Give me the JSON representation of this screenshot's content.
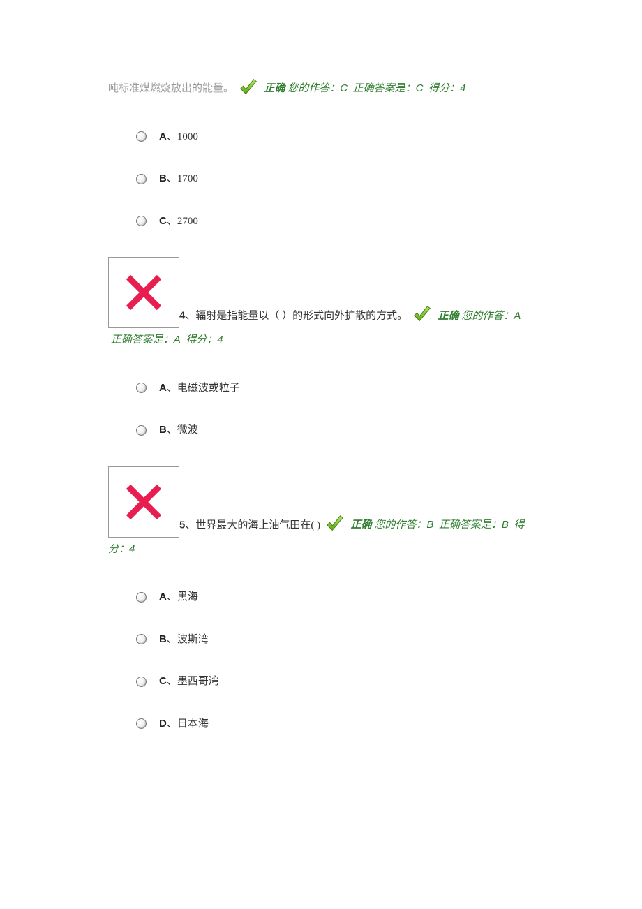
{
  "q3": {
    "intro_fragment": "吨标准煤燃烧放出的能量。",
    "feedback_correct": "正确",
    "feedback_your": "您的作答：",
    "feedback_your_v": "C",
    "feedback_right": "正确答案是：",
    "feedback_right_v": "C",
    "feedback_score_l": "得分：",
    "feedback_score_v": "4",
    "options": [
      {
        "letter": "A",
        "text": "1000"
      },
      {
        "letter": "B",
        "text": "1700"
      },
      {
        "letter": "C",
        "text": "2700"
      }
    ]
  },
  "q4": {
    "num": "4",
    "text_before": "、辐射是指能量以（  ）的形式向外扩散的方式。",
    "feedback_correct": "正确",
    "feedback_your": "您的作答：",
    "feedback_your_v": "A",
    "feedback_right": "正确答案是：",
    "feedback_right_v": "A",
    "feedback_score_l": "得分：",
    "feedback_score_v": "4",
    "options": [
      {
        "letter": "A",
        "text": "电磁波或粒子"
      },
      {
        "letter": "B",
        "text": "微波"
      }
    ]
  },
  "q5": {
    "num": "5",
    "text_before": "、世界最大的海上油气田在(  )",
    "feedback_correct": "正确",
    "feedback_your": "您的作答：",
    "feedback_your_v": "B",
    "feedback_right": "正确答案是：",
    "feedback_right_v": "B",
    "feedback_score_l": "得分：",
    "feedback_score_v": "4",
    "options": [
      {
        "letter": "A",
        "text": "黑海"
      },
      {
        "letter": "B",
        "text": "波斯湾"
      },
      {
        "letter": "C",
        "text": "墨西哥湾"
      },
      {
        "letter": "D",
        "text": "日本海"
      }
    ]
  }
}
